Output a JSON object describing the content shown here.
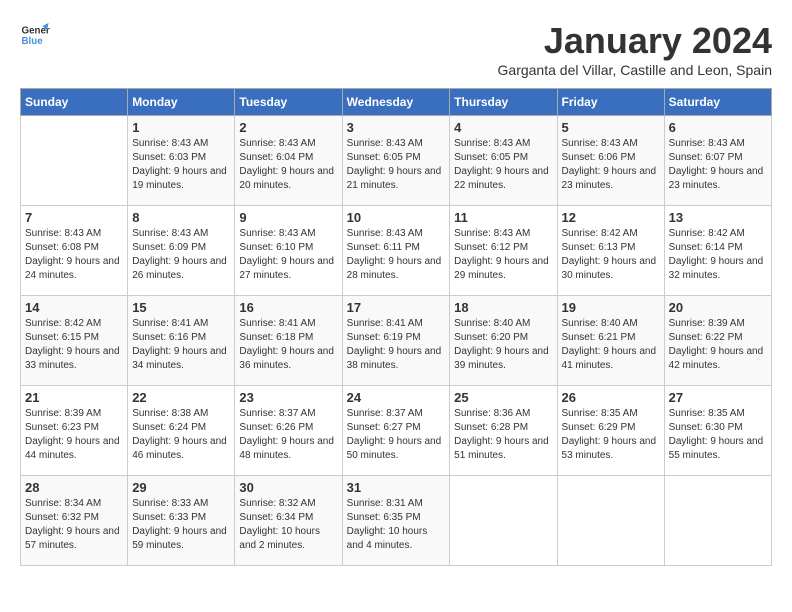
{
  "logo": {
    "line1": "General",
    "line2": "Blue"
  },
  "title": "January 2024",
  "subtitle": "Garganta del Villar, Castille and Leon, Spain",
  "days_header": [
    "Sunday",
    "Monday",
    "Tuesday",
    "Wednesday",
    "Thursday",
    "Friday",
    "Saturday"
  ],
  "weeks": [
    [
      {
        "num": "",
        "sunrise": "",
        "sunset": "",
        "daylight": ""
      },
      {
        "num": "1",
        "sunrise": "Sunrise: 8:43 AM",
        "sunset": "Sunset: 6:03 PM",
        "daylight": "Daylight: 9 hours and 19 minutes."
      },
      {
        "num": "2",
        "sunrise": "Sunrise: 8:43 AM",
        "sunset": "Sunset: 6:04 PM",
        "daylight": "Daylight: 9 hours and 20 minutes."
      },
      {
        "num": "3",
        "sunrise": "Sunrise: 8:43 AM",
        "sunset": "Sunset: 6:05 PM",
        "daylight": "Daylight: 9 hours and 21 minutes."
      },
      {
        "num": "4",
        "sunrise": "Sunrise: 8:43 AM",
        "sunset": "Sunset: 6:05 PM",
        "daylight": "Daylight: 9 hours and 22 minutes."
      },
      {
        "num": "5",
        "sunrise": "Sunrise: 8:43 AM",
        "sunset": "Sunset: 6:06 PM",
        "daylight": "Daylight: 9 hours and 23 minutes."
      },
      {
        "num": "6",
        "sunrise": "Sunrise: 8:43 AM",
        "sunset": "Sunset: 6:07 PM",
        "daylight": "Daylight: 9 hours and 23 minutes."
      }
    ],
    [
      {
        "num": "7",
        "sunrise": "Sunrise: 8:43 AM",
        "sunset": "Sunset: 6:08 PM",
        "daylight": "Daylight: 9 hours and 24 minutes."
      },
      {
        "num": "8",
        "sunrise": "Sunrise: 8:43 AM",
        "sunset": "Sunset: 6:09 PM",
        "daylight": "Daylight: 9 hours and 26 minutes."
      },
      {
        "num": "9",
        "sunrise": "Sunrise: 8:43 AM",
        "sunset": "Sunset: 6:10 PM",
        "daylight": "Daylight: 9 hours and 27 minutes."
      },
      {
        "num": "10",
        "sunrise": "Sunrise: 8:43 AM",
        "sunset": "Sunset: 6:11 PM",
        "daylight": "Daylight: 9 hours and 28 minutes."
      },
      {
        "num": "11",
        "sunrise": "Sunrise: 8:43 AM",
        "sunset": "Sunset: 6:12 PM",
        "daylight": "Daylight: 9 hours and 29 minutes."
      },
      {
        "num": "12",
        "sunrise": "Sunrise: 8:42 AM",
        "sunset": "Sunset: 6:13 PM",
        "daylight": "Daylight: 9 hours and 30 minutes."
      },
      {
        "num": "13",
        "sunrise": "Sunrise: 8:42 AM",
        "sunset": "Sunset: 6:14 PM",
        "daylight": "Daylight: 9 hours and 32 minutes."
      }
    ],
    [
      {
        "num": "14",
        "sunrise": "Sunrise: 8:42 AM",
        "sunset": "Sunset: 6:15 PM",
        "daylight": "Daylight: 9 hours and 33 minutes."
      },
      {
        "num": "15",
        "sunrise": "Sunrise: 8:41 AM",
        "sunset": "Sunset: 6:16 PM",
        "daylight": "Daylight: 9 hours and 34 minutes."
      },
      {
        "num": "16",
        "sunrise": "Sunrise: 8:41 AM",
        "sunset": "Sunset: 6:18 PM",
        "daylight": "Daylight: 9 hours and 36 minutes."
      },
      {
        "num": "17",
        "sunrise": "Sunrise: 8:41 AM",
        "sunset": "Sunset: 6:19 PM",
        "daylight": "Daylight: 9 hours and 38 minutes."
      },
      {
        "num": "18",
        "sunrise": "Sunrise: 8:40 AM",
        "sunset": "Sunset: 6:20 PM",
        "daylight": "Daylight: 9 hours and 39 minutes."
      },
      {
        "num": "19",
        "sunrise": "Sunrise: 8:40 AM",
        "sunset": "Sunset: 6:21 PM",
        "daylight": "Daylight: 9 hours and 41 minutes."
      },
      {
        "num": "20",
        "sunrise": "Sunrise: 8:39 AM",
        "sunset": "Sunset: 6:22 PM",
        "daylight": "Daylight: 9 hours and 42 minutes."
      }
    ],
    [
      {
        "num": "21",
        "sunrise": "Sunrise: 8:39 AM",
        "sunset": "Sunset: 6:23 PM",
        "daylight": "Daylight: 9 hours and 44 minutes."
      },
      {
        "num": "22",
        "sunrise": "Sunrise: 8:38 AM",
        "sunset": "Sunset: 6:24 PM",
        "daylight": "Daylight: 9 hours and 46 minutes."
      },
      {
        "num": "23",
        "sunrise": "Sunrise: 8:37 AM",
        "sunset": "Sunset: 6:26 PM",
        "daylight": "Daylight: 9 hours and 48 minutes."
      },
      {
        "num": "24",
        "sunrise": "Sunrise: 8:37 AM",
        "sunset": "Sunset: 6:27 PM",
        "daylight": "Daylight: 9 hours and 50 minutes."
      },
      {
        "num": "25",
        "sunrise": "Sunrise: 8:36 AM",
        "sunset": "Sunset: 6:28 PM",
        "daylight": "Daylight: 9 hours and 51 minutes."
      },
      {
        "num": "26",
        "sunrise": "Sunrise: 8:35 AM",
        "sunset": "Sunset: 6:29 PM",
        "daylight": "Daylight: 9 hours and 53 minutes."
      },
      {
        "num": "27",
        "sunrise": "Sunrise: 8:35 AM",
        "sunset": "Sunset: 6:30 PM",
        "daylight": "Daylight: 9 hours and 55 minutes."
      }
    ],
    [
      {
        "num": "28",
        "sunrise": "Sunrise: 8:34 AM",
        "sunset": "Sunset: 6:32 PM",
        "daylight": "Daylight: 9 hours and 57 minutes."
      },
      {
        "num": "29",
        "sunrise": "Sunrise: 8:33 AM",
        "sunset": "Sunset: 6:33 PM",
        "daylight": "Daylight: 9 hours and 59 minutes."
      },
      {
        "num": "30",
        "sunrise": "Sunrise: 8:32 AM",
        "sunset": "Sunset: 6:34 PM",
        "daylight": "Daylight: 10 hours and 2 minutes."
      },
      {
        "num": "31",
        "sunrise": "Sunrise: 8:31 AM",
        "sunset": "Sunset: 6:35 PM",
        "daylight": "Daylight: 10 hours and 4 minutes."
      },
      {
        "num": "",
        "sunrise": "",
        "sunset": "",
        "daylight": ""
      },
      {
        "num": "",
        "sunrise": "",
        "sunset": "",
        "daylight": ""
      },
      {
        "num": "",
        "sunrise": "",
        "sunset": "",
        "daylight": ""
      }
    ]
  ]
}
